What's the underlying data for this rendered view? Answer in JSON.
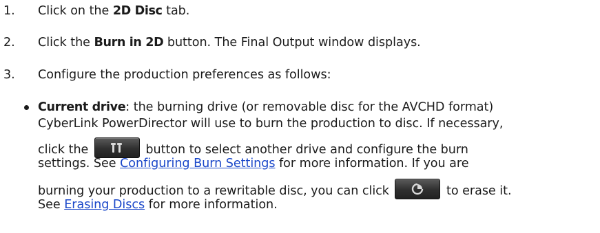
{
  "steps": [
    {
      "number": "1.",
      "pre": "Click on the ",
      "bold": "2D Disc",
      "post": " tab."
    },
    {
      "number": "2.",
      "pre": "Click the ",
      "bold": "Burn in 2D",
      "post": " button. The Final Output window displays."
    },
    {
      "number": "3.",
      "text": "Configure the production preferences as follows:"
    }
  ],
  "bullet": {
    "term": "Current drive",
    "line1": ": the burning drive (or removable disc for the AVCHD format)",
    "line2": "CyberLink PowerDirector will use to burn the production to disc. If necessary,",
    "line3_pre": "click the ",
    "line3_post": " button to select another drive and configure the burn",
    "line4_pre": "settings. See ",
    "line4_link": "Configuring Burn Settings",
    "line4_post": " for more information. If you are",
    "line5_pre": "burning your production to a rewritable disc, you can click ",
    "line5_post": " to erase it.",
    "line6_pre": "See ",
    "line6_link": "Erasing Discs",
    "line6_post": " for more information."
  },
  "icons": {
    "settings": "settings-tools-icon",
    "erase": "erase-disc-icon"
  },
  "colors": {
    "link": "#1a47c9",
    "button": "#3a3a3a"
  }
}
